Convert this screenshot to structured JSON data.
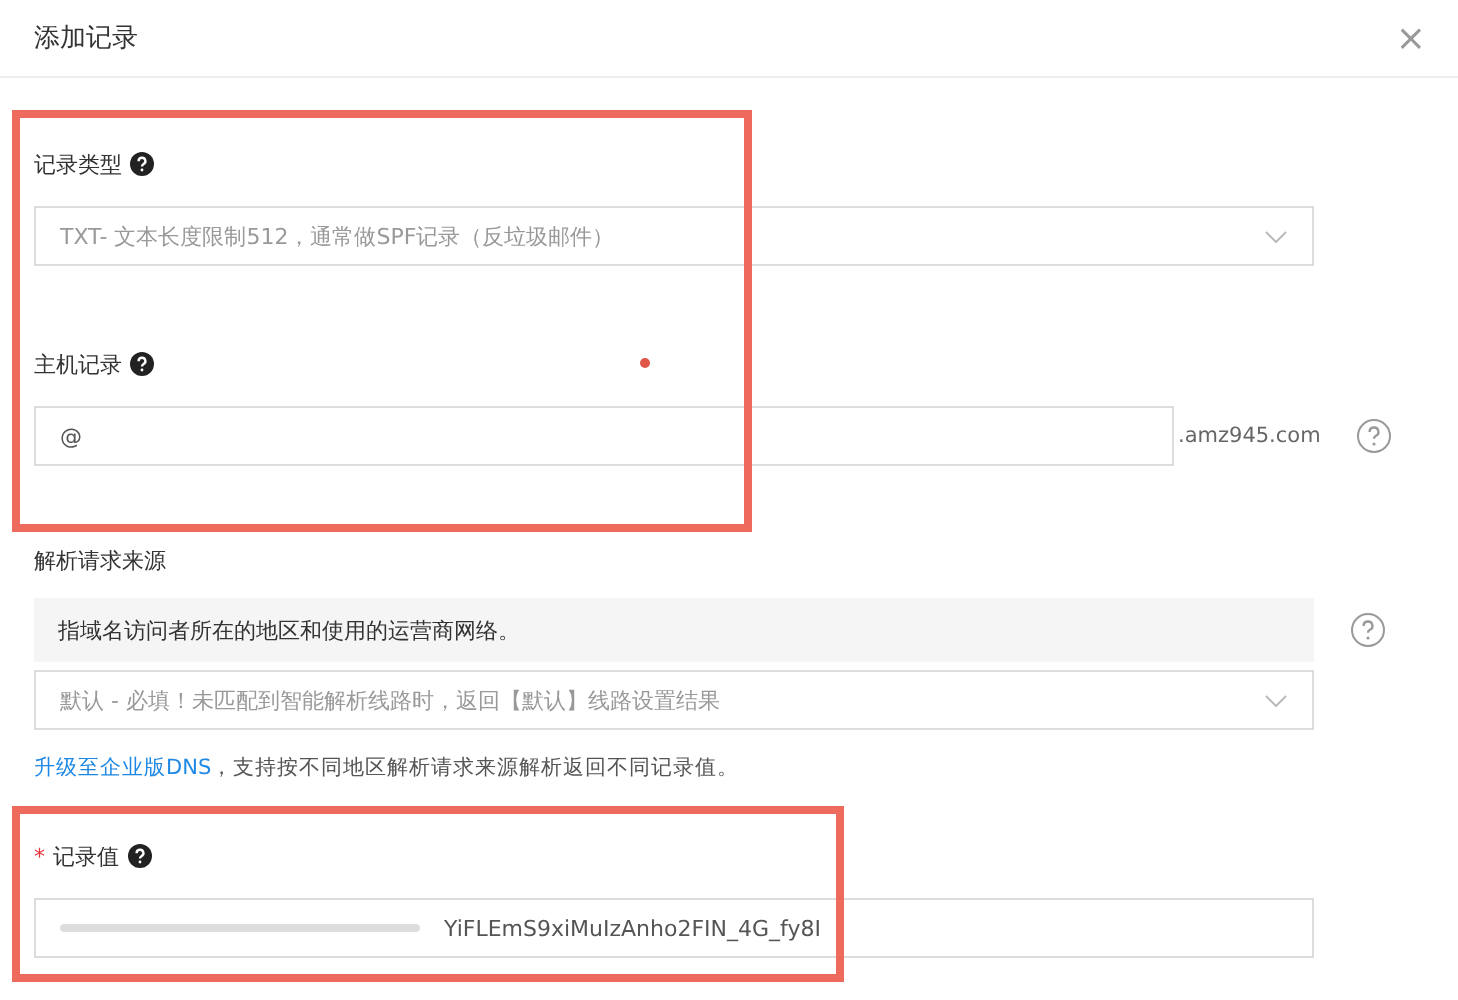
{
  "dialog": {
    "title": "添加记录",
    "close": "×"
  },
  "fields": [
    {
      "kind": "select",
      "label": "记录类型",
      "help": true,
      "value": "TXT- 文本长度限制512，通常做SPF记录（反垃圾邮件）"
    },
    {
      "kind": "input",
      "label": "主机记录",
      "help": true,
      "value": "@",
      "suffix": ".amz945.com"
    },
    {
      "kind": "line",
      "label": "解析请求来源",
      "help": false,
      "info": "指域名访问者所在的地区和使用的运营商网络。",
      "value": "默认 - 必填！未匹配到智能解析线路时，返回【默认】线路设置结果",
      "note_link": "升级至企业版DNS",
      "note": "，支持按不同地区解析请求来源解析返回不同记录值。"
    },
    {
      "kind": "input",
      "label": "记录值",
      "required_mark": "*",
      "help": true,
      "value": "YiFLEmS9xiMuIzAnho2FIN_4G_fy8I",
      "redacted": true
    }
  ]
}
